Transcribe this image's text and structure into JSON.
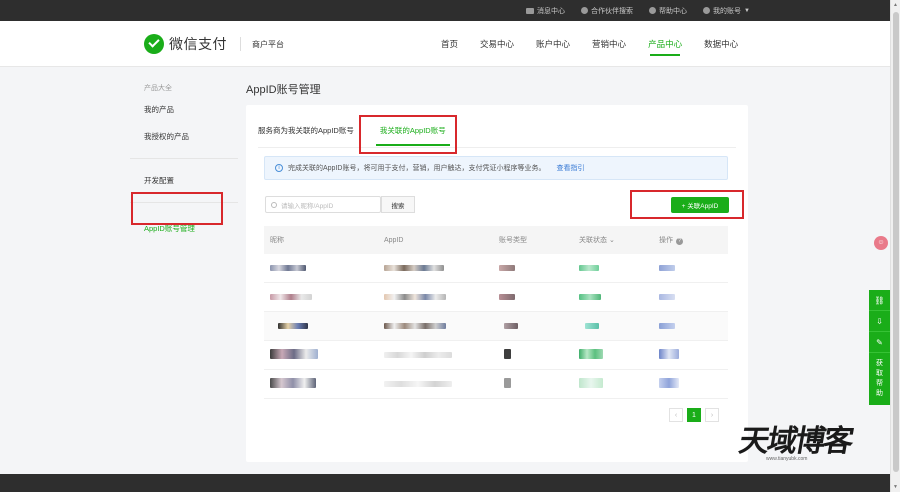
{
  "topbar": {
    "links": [
      {
        "label": "消息中心",
        "icon": "mail-icon"
      },
      {
        "label": "合作伙伴搜索",
        "icon": "globe-icon"
      },
      {
        "label": "帮助中心",
        "icon": "question-icon"
      },
      {
        "label": "我的账号",
        "icon": "user-icon"
      }
    ]
  },
  "header": {
    "brand": "微信支付",
    "subtitle": "商户平台",
    "nav": [
      "首页",
      "交易中心",
      "账户中心",
      "营销中心",
      "产品中心",
      "数据中心"
    ],
    "active_nav": "产品中心"
  },
  "sidebar": {
    "group_title": "产品大全",
    "items_a": [
      "我的产品",
      "我授权的产品"
    ],
    "item_b": "开发配置",
    "item_c": "AppID账号管理"
  },
  "page": {
    "title": "AppID账号管理",
    "tabs": [
      "服务商为我关联的AppID账号",
      "我关联的AppID账号"
    ],
    "active_tab": "我关联的AppID账号",
    "notice": "完成关联的AppID账号，将可用于支付，营销，用户触达，支付凭证小程序等业务。",
    "notice_link": "查看指引",
    "search_placeholder": "请输入昵称/AppID",
    "search_button": "搜索",
    "add_button": "+ 关联AppID",
    "columns": [
      "昵称",
      "AppID",
      "账号类型",
      "关联状态",
      "操作"
    ],
    "pagination": {
      "current": "1",
      "prev": "‹",
      "next": "›"
    }
  },
  "tools": {
    "help_label": [
      "获",
      "取",
      "帮",
      "助"
    ]
  },
  "watermark": {
    "text": "天域博客",
    "url": "www.tianyubk.com"
  },
  "colors": {
    "brand_green": "#1aad19",
    "highlight_red": "#d8282c",
    "dark_bar": "#2e2e2e"
  }
}
